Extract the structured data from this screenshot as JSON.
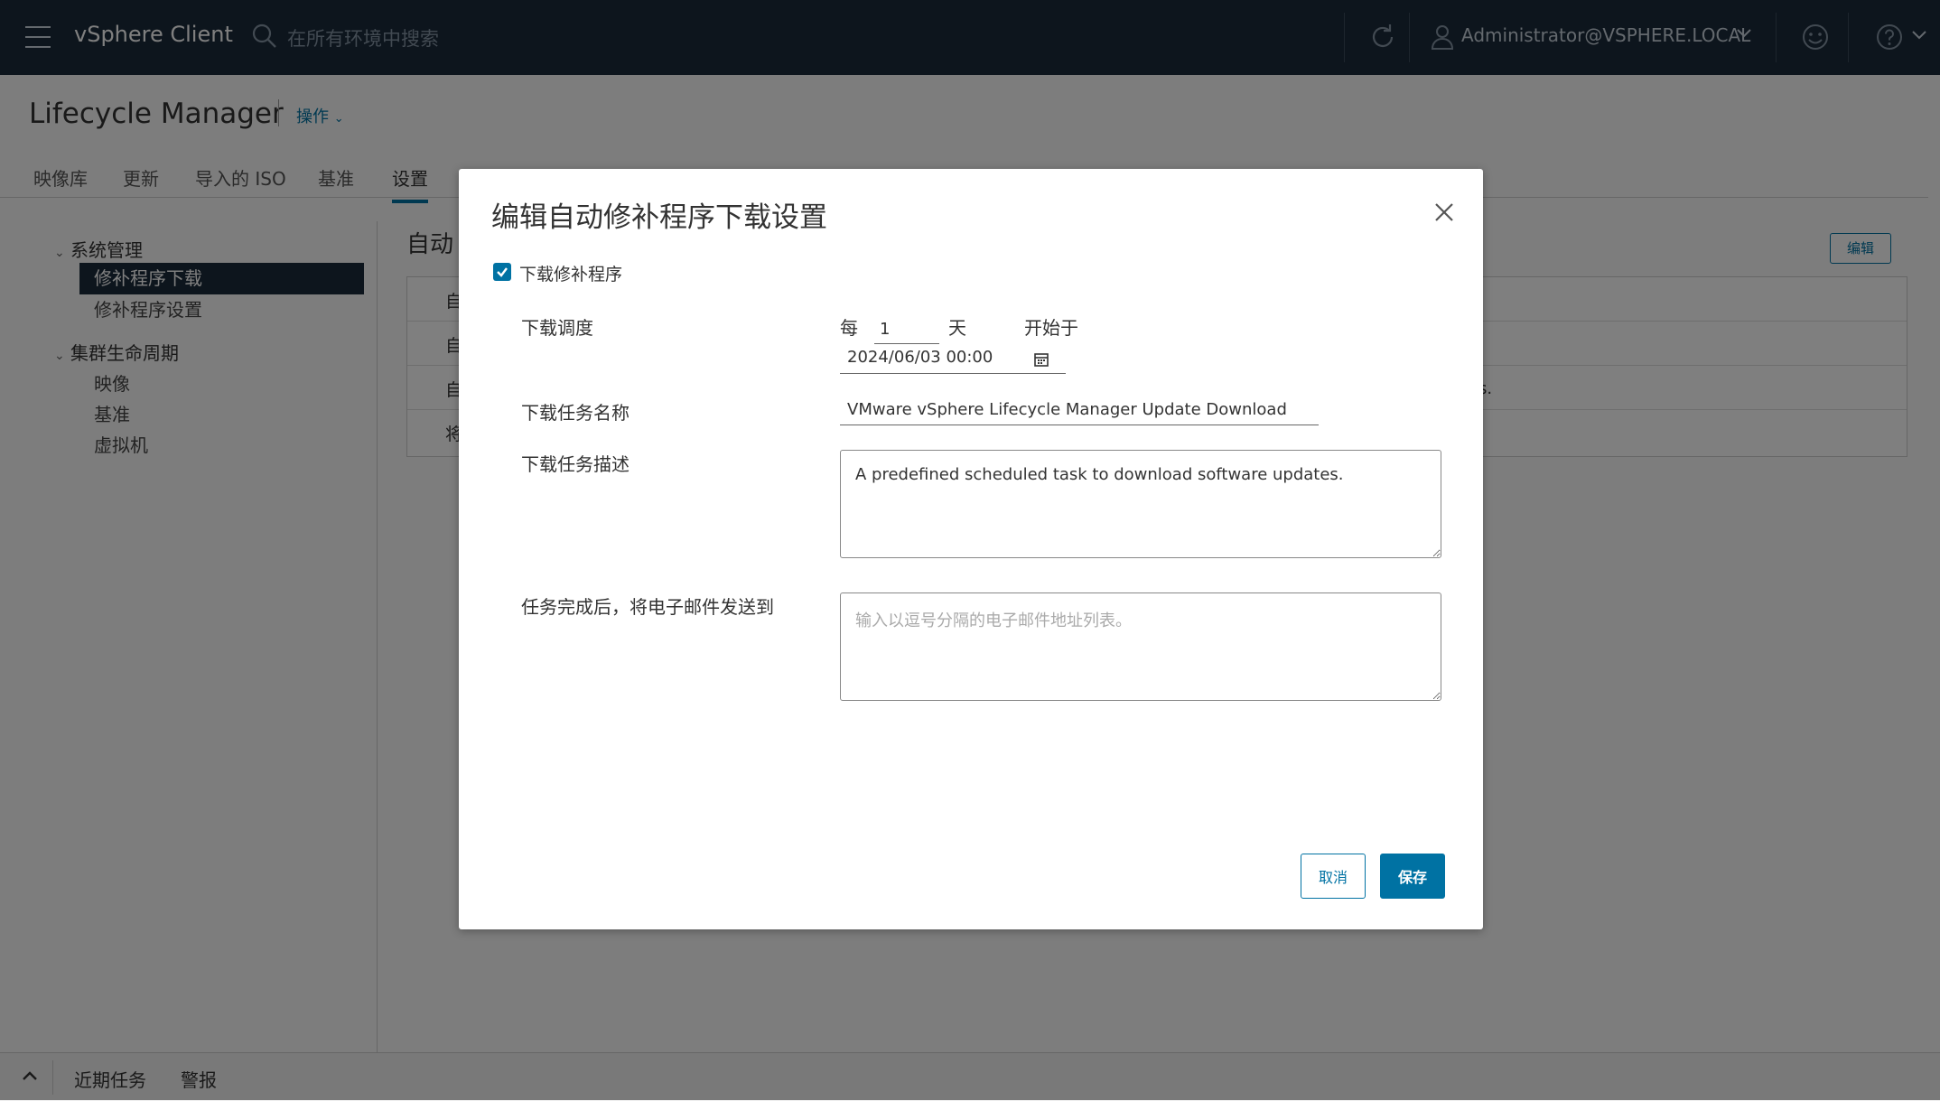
{
  "header": {
    "app_title": "vSphere Client",
    "search_placeholder": "在所有环境中搜索",
    "user": "Administrator@VSPHERE.LOCAL"
  },
  "page": {
    "title": "Lifecycle Manager",
    "actions_label": "操作",
    "tabs": [
      {
        "label": "映像库"
      },
      {
        "label": "更新"
      },
      {
        "label": "导入的 ISO"
      },
      {
        "label": "基准"
      },
      {
        "label": "设置",
        "active": true
      }
    ]
  },
  "nav": {
    "groups": [
      {
        "label": "系统管理",
        "items": [
          "修补程序下载",
          "修补程序设置"
        ]
      },
      {
        "label": "集群生命周期",
        "items": [
          "映像",
          "基准",
          "虚拟机"
        ]
      }
    ],
    "selected": "修补程序下载"
  },
  "content": {
    "heading": "自动",
    "edit_label": "编辑",
    "rows": [
      "自",
      "自",
      "自",
      "将"
    ],
    "trailing_text": "s."
  },
  "bottom": {
    "tabs": [
      "近期任务",
      "警报"
    ]
  },
  "modal": {
    "title": "编辑自动修补程序下载设置",
    "checkbox_label": "下载修补程序",
    "checkbox_checked": true,
    "schedule": {
      "label": "下载调度",
      "every": "每",
      "value": "1",
      "unit": "天",
      "start_at": "开始于",
      "datetime": "2024/06/03 00:00"
    },
    "task_name": {
      "label": "下载任务名称",
      "value": "VMware vSphere Lifecycle Manager Update Download"
    },
    "task_description": {
      "label": "下载任务描述",
      "value": "A predefined scheduled task to download software updates."
    },
    "email": {
      "label": "任务完成后，将电子邮件发送到",
      "placeholder": "输入以逗号分隔的电子邮件地址列表。"
    },
    "buttons": {
      "cancel": "取消",
      "save": "保存"
    }
  },
  "colors": {
    "header_bg": "#1b2a3a",
    "accent": "#0072a3",
    "overlay": "rgba(0,0,0,0.5)"
  }
}
